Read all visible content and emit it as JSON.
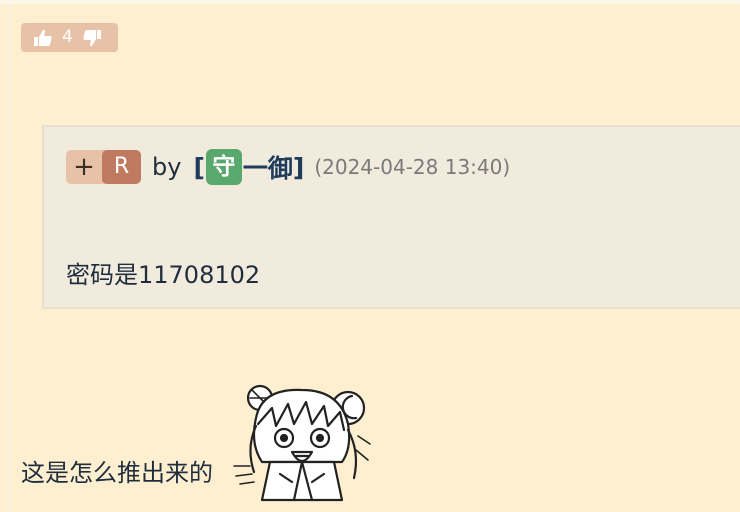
{
  "votes": {
    "count": "4",
    "up_icon": "thumbs-up-icon",
    "down_icon": "thumbs-down-icon",
    "badge_color": "#e7c2a6"
  },
  "quote": {
    "plus_label": "+",
    "reply_label": "R",
    "by_label": "by",
    "user_open_bracket": "[",
    "user_badge_char": "守",
    "user_name": "一御",
    "user_close_bracket": "]",
    "timestamp": "(2024-04-28 13:40)",
    "body": "密码是11708102",
    "badge_color": "#59a96f"
  },
  "reply": {
    "text": "这是怎么推出来的"
  },
  "sticker": {
    "icon": "anime-girl-sticker"
  }
}
